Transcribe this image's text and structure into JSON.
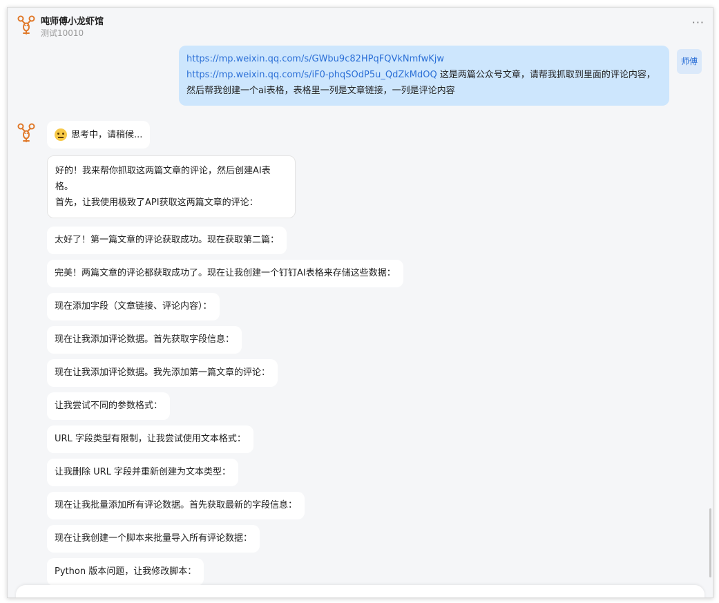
{
  "header": {
    "title": "吨师傅小龙虾馆",
    "subtitle": "测试10010",
    "more": "···"
  },
  "user_message": {
    "link1": "https://mp.weixin.qq.com/s/GWbu9c82HPqFQVkNmfwKjw",
    "link2": "https://mp.weixin.qq.com/s/iF0-phqSOdP5u_QdZkMdOQ",
    "text": " 这是两篇公众号文章，请帮我抓取到里面的评论内容，然后帮我创建一个ai表格，表格里一列是文章链接，一列是评论内容"
  },
  "user_avatar": "师傅",
  "thinking": "思考中，请稍候...",
  "messages": [
    "好的！我来帮你抓取这两篇文章的评论，然后创建AI表格。",
    "首先，让我使用极致了API获取这两篇文章的评论：",
    "太好了！第一篇文章的评论获取成功。现在获取第二篇：",
    "完美！两篇文章的评论都获取成功了。现在让我创建一个钉钉AI表格来存储这些数据：",
    "现在添加字段（文章链接、评论内容）：",
    "现在让我添加评论数据。首先获取字段信息：",
    "现在让我添加评论数据。我先添加第一篇文章的评论：",
    "让我尝试不同的参数格式：",
    "URL 字段类型有限制，让我尝试使用文本格式：",
    "让我删除 URL 字段并重新创建为文本类型：",
    "现在让我批量添加所有评论数据。首先获取最新的字段信息：",
    "现在让我创建一个脚本来批量导入所有评论数据：",
    "Python 版本问题，让我修改脚本："
  ],
  "input": {
    "placeholder": ""
  },
  "colors": {
    "accent": "#2b6fd6",
    "user_bubble": "#cde6fd",
    "logo": "#e0792a"
  }
}
